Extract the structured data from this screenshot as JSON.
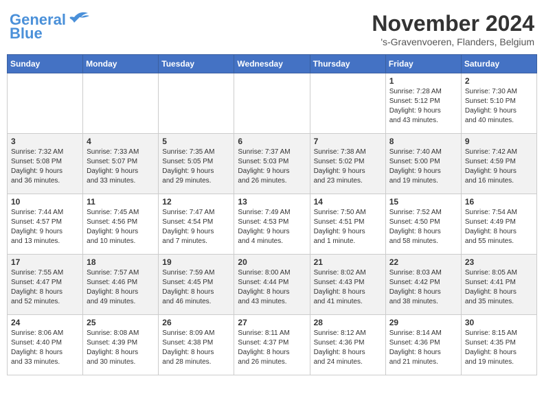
{
  "header": {
    "logo_line1": "General",
    "logo_line2": "Blue",
    "month": "November 2024",
    "location": "'s-Gravenvoeren, Flanders, Belgium"
  },
  "days_of_week": [
    "Sunday",
    "Monday",
    "Tuesday",
    "Wednesday",
    "Thursday",
    "Friday",
    "Saturday"
  ],
  "weeks": [
    [
      {
        "day": "",
        "info": ""
      },
      {
        "day": "",
        "info": ""
      },
      {
        "day": "",
        "info": ""
      },
      {
        "day": "",
        "info": ""
      },
      {
        "day": "",
        "info": ""
      },
      {
        "day": "1",
        "info": "Sunrise: 7:28 AM\nSunset: 5:12 PM\nDaylight: 9 hours\nand 43 minutes."
      },
      {
        "day": "2",
        "info": "Sunrise: 7:30 AM\nSunset: 5:10 PM\nDaylight: 9 hours\nand 40 minutes."
      }
    ],
    [
      {
        "day": "3",
        "info": "Sunrise: 7:32 AM\nSunset: 5:08 PM\nDaylight: 9 hours\nand 36 minutes."
      },
      {
        "day": "4",
        "info": "Sunrise: 7:33 AM\nSunset: 5:07 PM\nDaylight: 9 hours\nand 33 minutes."
      },
      {
        "day": "5",
        "info": "Sunrise: 7:35 AM\nSunset: 5:05 PM\nDaylight: 9 hours\nand 29 minutes."
      },
      {
        "day": "6",
        "info": "Sunrise: 7:37 AM\nSunset: 5:03 PM\nDaylight: 9 hours\nand 26 minutes."
      },
      {
        "day": "7",
        "info": "Sunrise: 7:38 AM\nSunset: 5:02 PM\nDaylight: 9 hours\nand 23 minutes."
      },
      {
        "day": "8",
        "info": "Sunrise: 7:40 AM\nSunset: 5:00 PM\nDaylight: 9 hours\nand 19 minutes."
      },
      {
        "day": "9",
        "info": "Sunrise: 7:42 AM\nSunset: 4:59 PM\nDaylight: 9 hours\nand 16 minutes."
      }
    ],
    [
      {
        "day": "10",
        "info": "Sunrise: 7:44 AM\nSunset: 4:57 PM\nDaylight: 9 hours\nand 13 minutes."
      },
      {
        "day": "11",
        "info": "Sunrise: 7:45 AM\nSunset: 4:56 PM\nDaylight: 9 hours\nand 10 minutes."
      },
      {
        "day": "12",
        "info": "Sunrise: 7:47 AM\nSunset: 4:54 PM\nDaylight: 9 hours\nand 7 minutes."
      },
      {
        "day": "13",
        "info": "Sunrise: 7:49 AM\nSunset: 4:53 PM\nDaylight: 9 hours\nand 4 minutes."
      },
      {
        "day": "14",
        "info": "Sunrise: 7:50 AM\nSunset: 4:51 PM\nDaylight: 9 hours\nand 1 minute."
      },
      {
        "day": "15",
        "info": "Sunrise: 7:52 AM\nSunset: 4:50 PM\nDaylight: 8 hours\nand 58 minutes."
      },
      {
        "day": "16",
        "info": "Sunrise: 7:54 AM\nSunset: 4:49 PM\nDaylight: 8 hours\nand 55 minutes."
      }
    ],
    [
      {
        "day": "17",
        "info": "Sunrise: 7:55 AM\nSunset: 4:47 PM\nDaylight: 8 hours\nand 52 minutes."
      },
      {
        "day": "18",
        "info": "Sunrise: 7:57 AM\nSunset: 4:46 PM\nDaylight: 8 hours\nand 49 minutes."
      },
      {
        "day": "19",
        "info": "Sunrise: 7:59 AM\nSunset: 4:45 PM\nDaylight: 8 hours\nand 46 minutes."
      },
      {
        "day": "20",
        "info": "Sunrise: 8:00 AM\nSunset: 4:44 PM\nDaylight: 8 hours\nand 43 minutes."
      },
      {
        "day": "21",
        "info": "Sunrise: 8:02 AM\nSunset: 4:43 PM\nDaylight: 8 hours\nand 41 minutes."
      },
      {
        "day": "22",
        "info": "Sunrise: 8:03 AM\nSunset: 4:42 PM\nDaylight: 8 hours\nand 38 minutes."
      },
      {
        "day": "23",
        "info": "Sunrise: 8:05 AM\nSunset: 4:41 PM\nDaylight: 8 hours\nand 35 minutes."
      }
    ],
    [
      {
        "day": "24",
        "info": "Sunrise: 8:06 AM\nSunset: 4:40 PM\nDaylight: 8 hours\nand 33 minutes."
      },
      {
        "day": "25",
        "info": "Sunrise: 8:08 AM\nSunset: 4:39 PM\nDaylight: 8 hours\nand 30 minutes."
      },
      {
        "day": "26",
        "info": "Sunrise: 8:09 AM\nSunset: 4:38 PM\nDaylight: 8 hours\nand 28 minutes."
      },
      {
        "day": "27",
        "info": "Sunrise: 8:11 AM\nSunset: 4:37 PM\nDaylight: 8 hours\nand 26 minutes."
      },
      {
        "day": "28",
        "info": "Sunrise: 8:12 AM\nSunset: 4:36 PM\nDaylight: 8 hours\nand 24 minutes."
      },
      {
        "day": "29",
        "info": "Sunrise: 8:14 AM\nSunset: 4:36 PM\nDaylight: 8 hours\nand 21 minutes."
      },
      {
        "day": "30",
        "info": "Sunrise: 8:15 AM\nSunset: 4:35 PM\nDaylight: 8 hours\nand 19 minutes."
      }
    ]
  ]
}
